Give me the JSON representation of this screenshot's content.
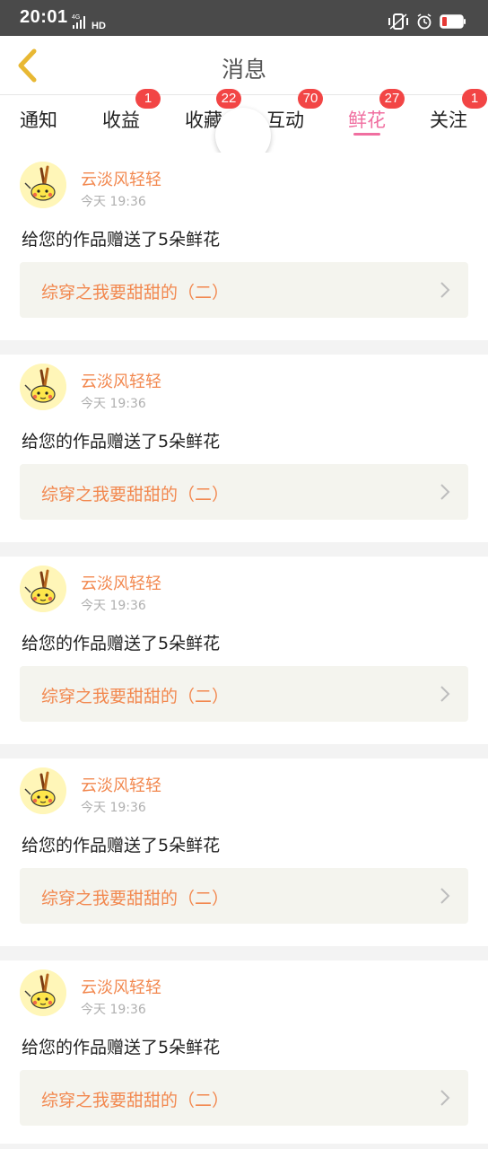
{
  "status_bar": {
    "time": "20:01",
    "left_icons": [
      "signal-4g-icon",
      "hd-icon"
    ],
    "right_icons": [
      "vibrate-icon",
      "alarm-icon",
      "battery-low-icon"
    ],
    "background": "#4a4a4a"
  },
  "header": {
    "title": "消息",
    "back_icon": "chevron-left-icon",
    "back_icon_color": "#e8b833"
  },
  "tabs": [
    {
      "label": "通知",
      "badge": null,
      "active": false
    },
    {
      "label": "收益",
      "badge": "1",
      "active": false
    },
    {
      "label": "收藏",
      "badge": "22",
      "active": false
    },
    {
      "label": "互动",
      "badge": "70",
      "active": false
    },
    {
      "label": "鲜花",
      "badge": "27",
      "active": true
    },
    {
      "label": "关注",
      "badge": "1",
      "active": false
    }
  ],
  "colors": {
    "accent_pink": "#f06fa0",
    "badge_red": "#f24545",
    "username_orange": "#f2884f",
    "link_bg": "#f4f4ee"
  },
  "messages": [
    {
      "username": "云淡风轻轻",
      "time": "今天 19:36",
      "text": "给您的作品赠送了5朵鲜花",
      "work_title": "综穿之我要甜甜的（二）",
      "avatar_icon": "pikachu-avatar-icon"
    },
    {
      "username": "云淡风轻轻",
      "time": "今天 19:36",
      "text": "给您的作品赠送了5朵鲜花",
      "work_title": "综穿之我要甜甜的（二）",
      "avatar_icon": "pikachu-avatar-icon"
    },
    {
      "username": "云淡风轻轻",
      "time": "今天 19:36",
      "text": "给您的作品赠送了5朵鲜花",
      "work_title": "综穿之我要甜甜的（二）",
      "avatar_icon": "pikachu-avatar-icon"
    },
    {
      "username": "云淡风轻轻",
      "time": "今天 19:36",
      "text": "给您的作品赠送了5朵鲜花",
      "work_title": "综穿之我要甜甜的（二）",
      "avatar_icon": "pikachu-avatar-icon"
    },
    {
      "username": "云淡风轻轻",
      "time": "今天 19:36",
      "text": "给您的作品赠送了5朵鲜花",
      "work_title": "综穿之我要甜甜的（二）",
      "avatar_icon": "pikachu-avatar-icon"
    }
  ]
}
